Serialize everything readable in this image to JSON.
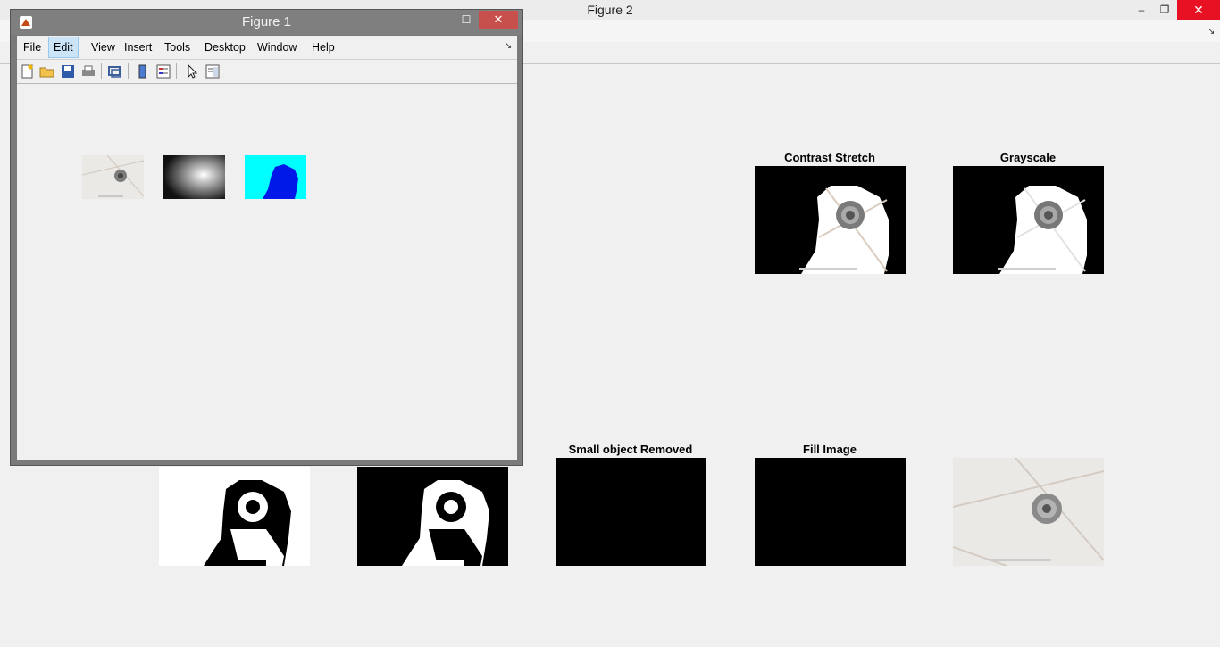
{
  "figure2": {
    "title": "Figure 2",
    "controls": {
      "minimize": "–",
      "restore": "❐",
      "close": "✕"
    },
    "axes_titles": {
      "contrast": "Contrast Stretch",
      "grayscale": "Grayscale",
      "small": "Small object Removed",
      "fill": "Fill Image"
    }
  },
  "figure1": {
    "title": "Figure 1",
    "controls": {
      "minimize": "–",
      "maximize": "☐",
      "close": "✕"
    },
    "menu": [
      "File",
      "Edit",
      "View",
      "Insert",
      "Tools",
      "Desktop",
      "Window",
      "Help"
    ],
    "toolbar_icons": [
      "new-figure-icon",
      "open-file-icon",
      "save-icon",
      "print-icon",
      "link-icon",
      "colorbar-icon",
      "legend-icon",
      "pointer-icon",
      "property-editor-icon"
    ]
  },
  "colors": {
    "fig1_titlebar": "#7f7f7f",
    "close_red": "#e81123",
    "segment_blue": "#0018e8",
    "segment_cyan": "#00ffff"
  }
}
